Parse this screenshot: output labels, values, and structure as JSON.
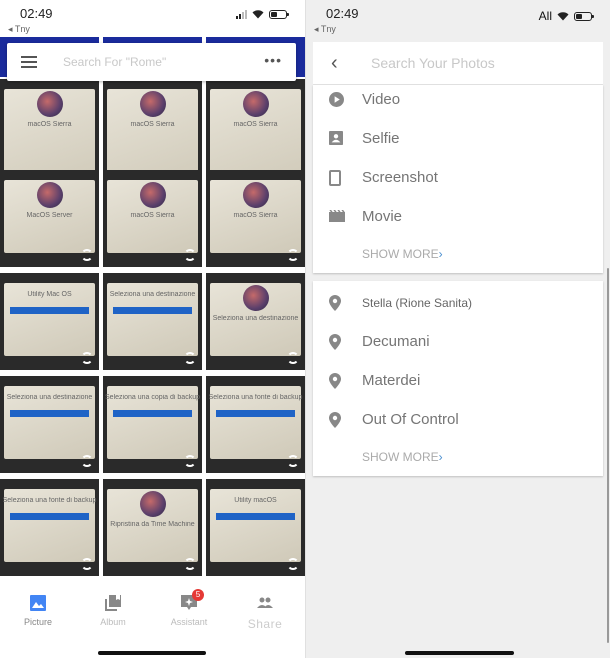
{
  "left_screen": {
    "status_bar": {
      "time": "02:49",
      "back_label": "◂ Tny",
      "signal_bars": 2,
      "battery_level": 0.45
    },
    "search": {
      "placeholder": "Search For \"Rome\"",
      "menu_icon": "hamburger-icon",
      "more_icon": "more-dots-icon",
      "more_glyph": "•••"
    },
    "photo_grid": {
      "tiles": [
        {
          "title": "macOS Sierra",
          "style": "dialog"
        },
        {
          "title": "macOS Sierra",
          "style": "logo"
        },
        {
          "title": "macOS Sierra",
          "style": "dialog"
        },
        {
          "title": "MacOS Server",
          "style": "logo"
        },
        {
          "title": "macOS Sierra",
          "style": "dialog"
        },
        {
          "title": "macOS Sierra",
          "style": "logo"
        },
        {
          "title": "Utility Mac OS",
          "style": "list"
        },
        {
          "title": "Seleziona una destinazione",
          "style": "list"
        },
        {
          "title": "Seleziona una destinazione",
          "style": "dialog"
        },
        {
          "title": "Seleziona una destinazione",
          "style": "list"
        },
        {
          "title": "Seleziona una copia di backup",
          "style": "list"
        },
        {
          "title": "Seleziona una fonte di backup",
          "style": "list"
        },
        {
          "title": "Seleziona una fonte di backup",
          "style": "list"
        },
        {
          "title": "Ripristina da Time Machine",
          "style": "logo"
        },
        {
          "title": "Utility macOS",
          "style": "list"
        }
      ]
    },
    "bottom_nav": {
      "items": [
        {
          "label": "Picture",
          "icon": "photo-icon",
          "active": true
        },
        {
          "label": "Album",
          "icon": "album-icon",
          "active": false
        },
        {
          "label": "Assistant",
          "icon": "assistant-icon",
          "active": false,
          "badge": "5"
        },
        {
          "label": "Share",
          "icon": "share-people-icon",
          "active": false
        }
      ]
    }
  },
  "right_screen": {
    "status_bar": {
      "time": "02:49",
      "back_label": "◂ Tny",
      "carrier": "All",
      "battery_level": 0.45
    },
    "search": {
      "placeholder": "Search Your Photos",
      "back_glyph": "‹"
    },
    "categories": {
      "items": [
        {
          "label": "Video",
          "icon": "play-circle-icon"
        },
        {
          "label": "Selfie",
          "icon": "selfie-portrait-icon"
        },
        {
          "label": "Screenshot",
          "icon": "phone-screenshot-icon"
        },
        {
          "label": "Movie",
          "icon": "clapperboard-icon"
        }
      ],
      "show_more": "SHOW MORE",
      "show_more_arrow": "›"
    },
    "places": {
      "items": [
        {
          "label": "Stella (Rione Sanita)",
          "icon": "location-pin-icon"
        },
        {
          "label": "Decumani",
          "icon": "location-pin-icon"
        },
        {
          "label": "Materdei",
          "icon": "location-pin-icon"
        },
        {
          "label": "Out Of Control",
          "icon": "location-pin-icon"
        }
      ],
      "show_more": "SHOW MORE",
      "show_more_arrow": "›"
    }
  },
  "colors": {
    "accent": "#4285f4",
    "badge": "#e53935",
    "icon_gray": "#888888",
    "panel_bg": "#efefef"
  }
}
